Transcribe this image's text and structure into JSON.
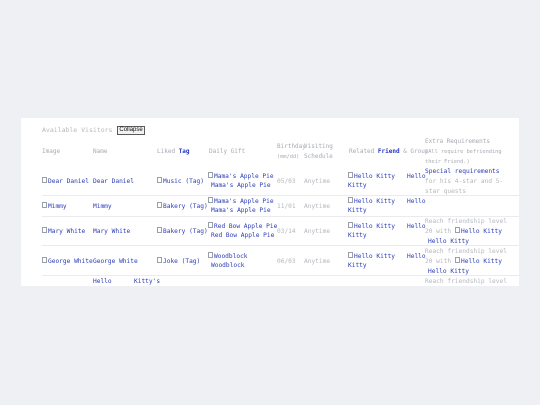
{
  "visitors": {
    "title": "Available Visitors",
    "collapse_label": "Collapse"
  },
  "headers": {
    "image": "Image",
    "name": "Name",
    "liked_pre": "Liked ",
    "liked_bold": "Tag",
    "daily_gift": "Daily Gift",
    "birthday": "Birthday",
    "birthday_sub": "(mm/dd)",
    "visit_1": "Visiting",
    "visit_2": "Schedule",
    "related_pre": "Related ",
    "related_bold": "Friend",
    "related_post": " & Group",
    "extra_1": "Extra Requirements",
    "extra_2": "(All require befriending",
    "extra_3": "their Friend.)"
  },
  "rows": [
    {
      "image": "Dear Daniel",
      "name": "Dear Daniel",
      "tag": "Music (Tag)",
      "gift_img": "Mama's Apple Pie",
      "gift": "Mama's Apple Pie",
      "birthday": "05/03",
      "schedule": "Anytime",
      "friend_img": "Hello Kitty",
      "group": "Hello",
      "friend_2": "Kitty",
      "req_1": "Special requirements",
      "req_2": "for his 4-star and 5-",
      "req_3": "star quests"
    },
    {
      "image": "Mimmy",
      "name": "Mimmy",
      "tag": "Bakery (Tag)",
      "gift_img": "Mama's Apple Pie",
      "gift": "Mama's Apple Pie",
      "birthday": "11/01",
      "schedule": "Anytime",
      "friend_img": "Hello Kitty",
      "group": "Hello",
      "friend_2": "Kitty"
    },
    {
      "image": "Mary White",
      "name": "Mary White",
      "tag": "Bakery (Tag)",
      "gift_img": "Red Bow Apple Pie",
      "gift": "Red Bow Apple Pie",
      "birthday": "03/14",
      "schedule": "Anytime",
      "friend_img": "Hello Kitty",
      "group": "Hello",
      "friend_2": "Kitty",
      "req_1": "Reach friendship level",
      "req_2": "20 with",
      "req_img": "Hello Kitty",
      "req_link": "Hello Kitty"
    },
    {
      "image": "George White",
      "name": "George White",
      "tag": "Joke (Tag)",
      "gift_img": "Woodblock",
      "gift": "Woodblock",
      "birthday": "06/03",
      "schedule": "Anytime",
      "friend_img": "Hello Kitty",
      "group": "Hello",
      "friend_2": "Kitty",
      "req_1": "Reach friendship level",
      "req_2": "20 with",
      "req_img": "Hello Kitty",
      "req_link": "Hello Kitty"
    },
    {
      "name_1": "Hello",
      "name_2": "Kitty's",
      "req_1": "Reach friendship level"
    }
  ]
}
